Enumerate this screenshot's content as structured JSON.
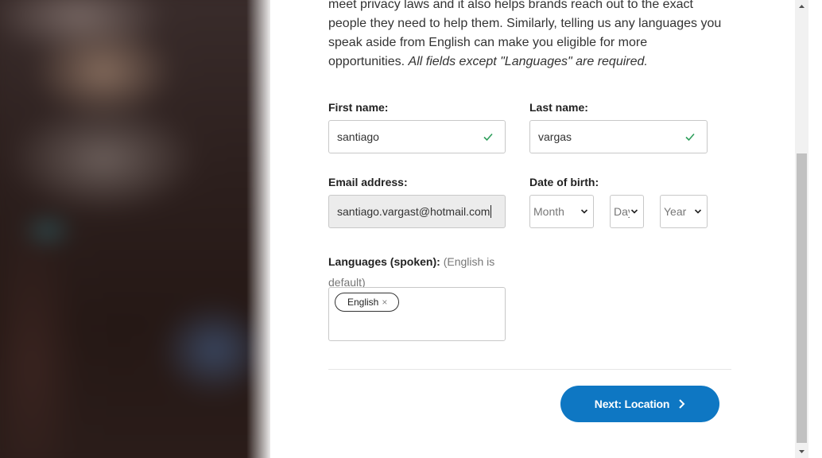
{
  "intro": {
    "line1": "meet privacy laws and it also helps brands reach out to the exact",
    "line2": "people they need to help them. Similarly, telling us any languages you",
    "line3": "speak aside from English can make you eligible for more",
    "line4_plain": "opportunities. ",
    "line4_italic": "All fields except \"Languages\" are required."
  },
  "form": {
    "first_name": {
      "label": "First name:",
      "value": "santiago"
    },
    "last_name": {
      "label": "Last name:",
      "value": "vargas"
    },
    "email": {
      "label": "Email address:",
      "value": "santiago.vargast@hotmail.com"
    },
    "dob": {
      "label": "Date of birth:",
      "month_placeholder": "Month",
      "day_placeholder": "Day",
      "year_placeholder": "Year"
    },
    "languages": {
      "label": "Languages (spoken):",
      "hint_line1": "(English is",
      "hint_line2": "default)",
      "tags": [
        "English"
      ],
      "remove_glyph": "×"
    }
  },
  "next_button": {
    "label": "Next: Location"
  },
  "colors": {
    "primary": "#0e77c3",
    "valid_check": "#2e9e5b",
    "disabled_bg": "#ececec"
  }
}
